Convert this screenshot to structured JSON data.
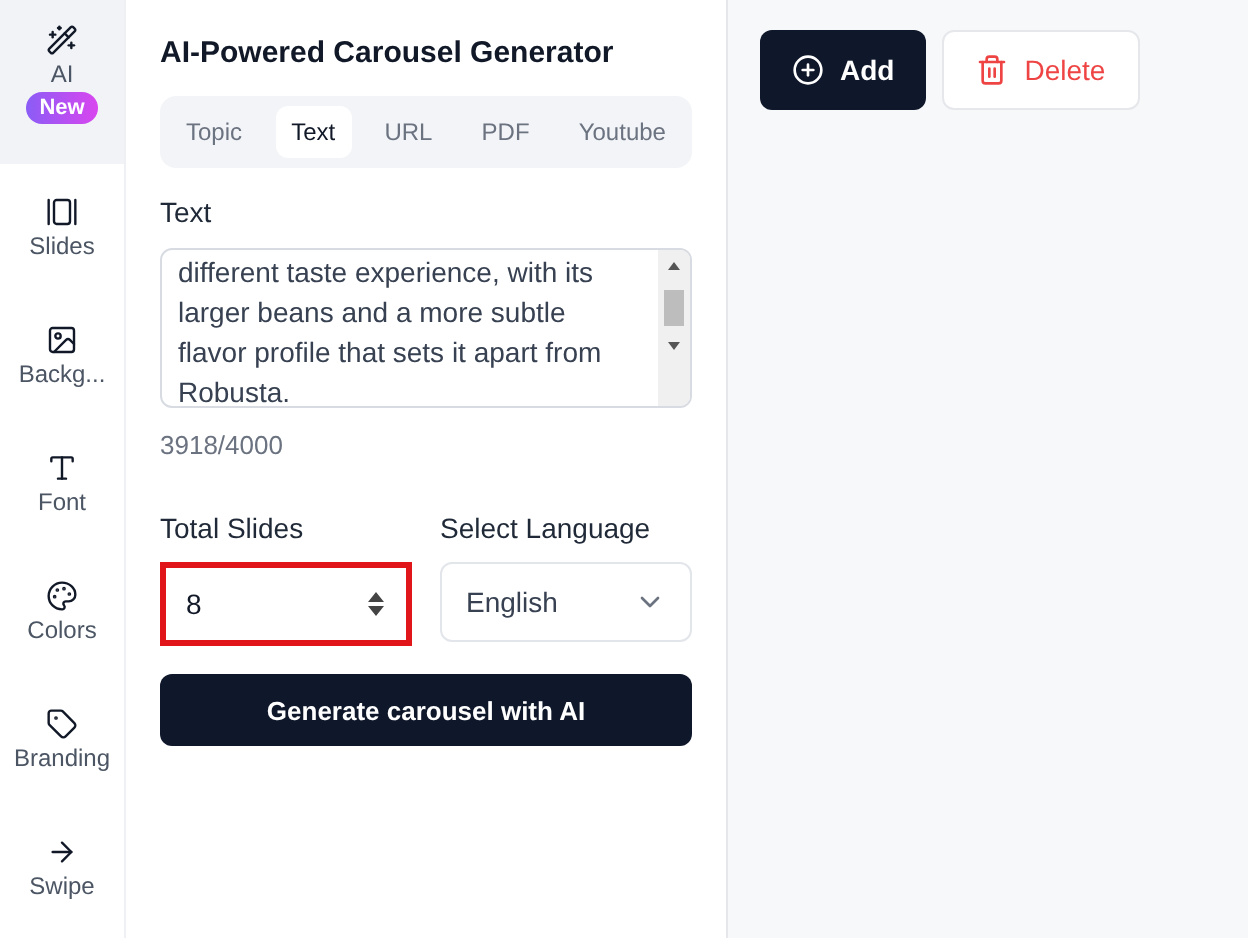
{
  "sidebar": {
    "items": [
      {
        "label": "AI",
        "selected": true,
        "badge": "New"
      },
      {
        "label": "Slides",
        "selected": false
      },
      {
        "label": "Backg...",
        "selected": false
      },
      {
        "label": "Font",
        "selected": false
      },
      {
        "label": "Colors",
        "selected": false
      },
      {
        "label": "Branding",
        "selected": false
      },
      {
        "label": "Swipe",
        "selected": false
      }
    ]
  },
  "panel": {
    "title": "AI-Powered Carousel Generator",
    "tabs": [
      {
        "label": "Topic",
        "selected": false
      },
      {
        "label": "Text",
        "selected": true
      },
      {
        "label": "URL",
        "selected": false
      },
      {
        "label": "PDF",
        "selected": false
      },
      {
        "label": "Youtube",
        "selected": false
      }
    ],
    "text_label": "Text",
    "text_value": "different taste experience, with its larger beans and a more subtle flavor profile that sets it apart from Robusta.",
    "counter": "3918/4000",
    "total_slides": {
      "label": "Total Slides",
      "value": "8",
      "highlighted": true
    },
    "language": {
      "label": "Select Language",
      "value": "English"
    },
    "generate_button": "Generate carousel with AI"
  },
  "toolbar": {
    "add_button": "Add",
    "delete_button": "Delete"
  }
}
